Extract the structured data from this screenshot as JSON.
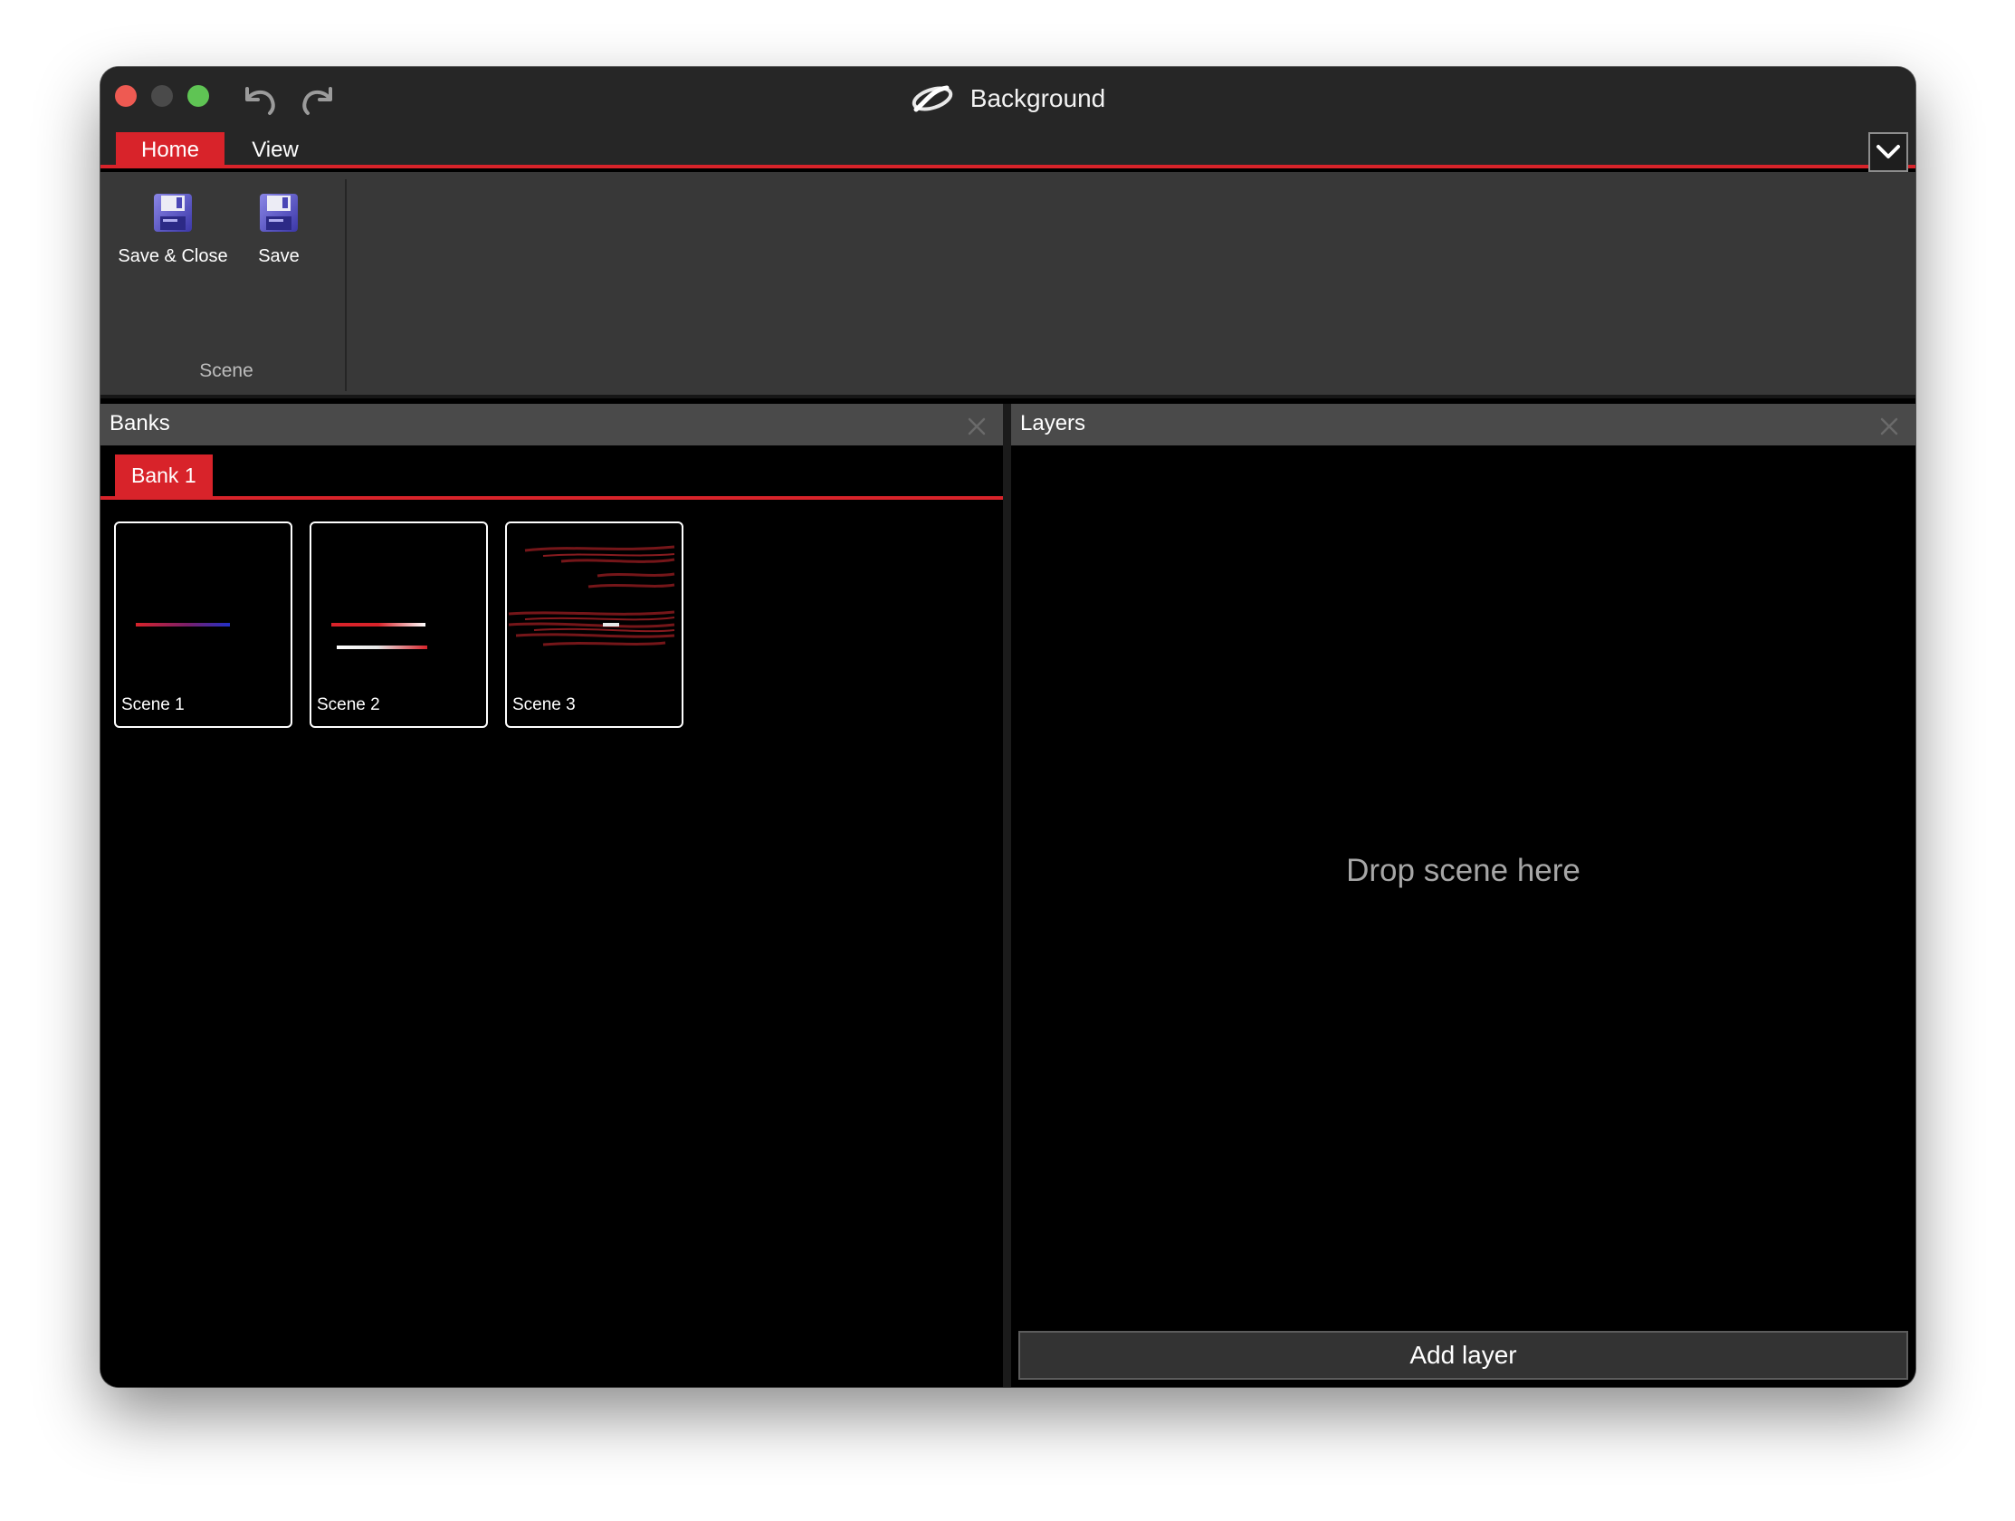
{
  "window": {
    "title": "Background",
    "logo_icon": "app-logo-icon"
  },
  "ribbon": {
    "tabs": [
      {
        "label": "Home",
        "active": true
      },
      {
        "label": "View",
        "active": false
      }
    ],
    "groups": [
      {
        "label": "Scene",
        "buttons": [
          {
            "label": "Save & Close",
            "icon": "floppy-disk-icon"
          },
          {
            "label": "Save",
            "icon": "floppy-disk-icon"
          }
        ]
      }
    ]
  },
  "banks_panel": {
    "title": "Banks",
    "bank_tabs": [
      {
        "label": "Bank 1",
        "active": true
      }
    ],
    "scenes": [
      {
        "label": "Scene 1"
      },
      {
        "label": "Scene 2"
      },
      {
        "label": "Scene 3"
      }
    ]
  },
  "layers_panel": {
    "title": "Layers",
    "placeholder": "Drop scene here",
    "add_button": "Add layer"
  },
  "colors": {
    "accent": "#d8232a",
    "titlebar": "#262626",
    "ribbon": "#383838",
    "panel_header": "#4a4a4a",
    "close_light": "#ee5a52",
    "max_light": "#5fc454"
  }
}
